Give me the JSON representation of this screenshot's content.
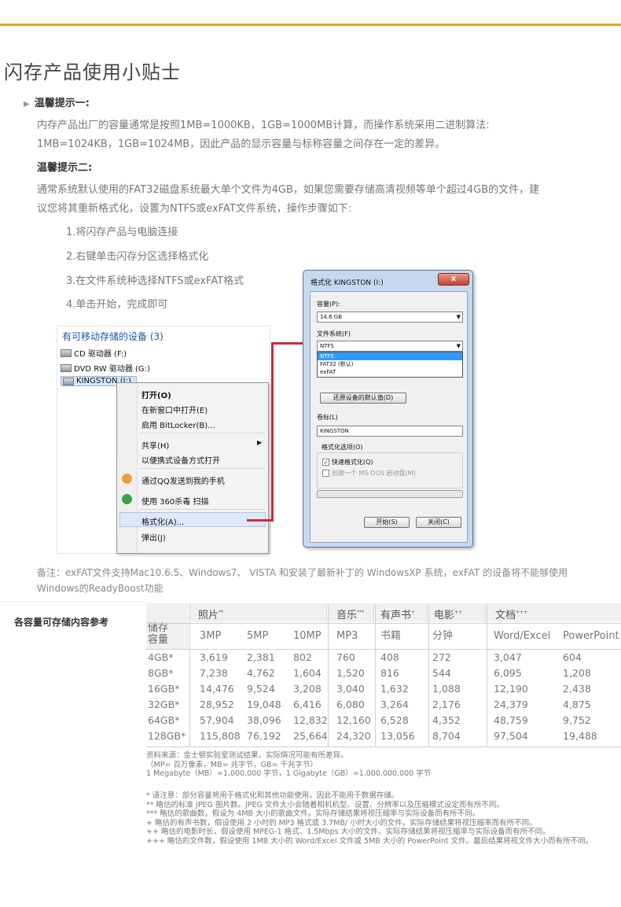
{
  "title": "闪存产品使用小贴士",
  "tip1": {
    "heading": "温馨提示一:",
    "line1": "内存产品出厂的容量通常是按照1MB=1000KB，1GB=1000MB计算，而操作系统采用二进制算法:",
    "line2": "1MB=1024KB，1GB=1024MB，因此产品的显示容量与标称容量之间存在一定的差异。"
  },
  "tip2": {
    "heading": "温馨提示二:",
    "line1": "通常系统默认使用的FAT32磁盘系统最大单个文件为4GB，如果您需要存储高清视频等单个超过4GB的文件，建",
    "line2": "议您将其重新格式化，设置为NTFS或exFAT文件系统，操作步骤如下:"
  },
  "steps": [
    "1.将闪存产品与电脑连接",
    "2.右键单击闪存分区选择格式化",
    "3.在文件系统种选择NTFS或exFAT格式",
    "4.单击开始，完成即可"
  ],
  "explorer": {
    "heading": "有可移动存储的设备 (3)",
    "drives": [
      "CD 驱动器 (F:)",
      "DVD RW 驱动器 (G:)",
      "KINGSTON (I:)"
    ]
  },
  "context_menu": {
    "items": [
      "打开(O)",
      "在新窗口中打开(E)",
      "启用 BitLocker(B)...",
      "共享(H)",
      "以便携式设备方式打开",
      "通过QQ发送到我的手机",
      "使用 360杀毒 扫描",
      "格式化(A)...",
      "弹出(J)"
    ]
  },
  "dialog": {
    "title": "格式化 KINGSTON (I:)",
    "close": "x",
    "capacity_label": "容量(P):",
    "capacity_value": "14.6 GB",
    "fs_label": "文件系统(F)",
    "fs_value": "NTFS",
    "fs_options": [
      "NTFS",
      "FAT32 (默认)",
      "exFAT"
    ],
    "restore_btn": "还原设备的默认值(D)",
    "volume_label": "卷标(L)",
    "volume_value": "KINGSTON",
    "options_label": "格式化选项(O)",
    "quick_format": "快速格式化(Q)",
    "msdos_disk": "创建一个 MS-DOS 启动盘(M)",
    "start_btn": "开始(S)",
    "close_btn": "关闭(C)"
  },
  "note": {
    "line1": "备注：exFAT文件支持Mac10.6.5、Windows7、  VISTA  和安装了最新补丁的 WindowsXP 系统，exFAT 的设备将不能够使用",
    "line2": "Windows的ReadyBoost功能"
  },
  "table": {
    "section_label": "各容量可存储内容参考",
    "corner_label_1": "储存",
    "corner_label_2": "容量",
    "groups": [
      {
        "name": "照片",
        "mark": "**"
      },
      {
        "name": "音乐",
        "mark": "***"
      },
      {
        "name": "有声书",
        "mark": "+"
      },
      {
        "name": "电影",
        "mark": "++"
      },
      {
        "name": "文档",
        "mark": "+++"
      }
    ],
    "subheaders": [
      "3MP",
      "5MP",
      "10MP",
      "MP3",
      "书籍",
      "分钟",
      "Word/Excel",
      "PowerPoint"
    ],
    "rows": [
      [
        "4GB*",
        "3,619",
        "2,381",
        "802",
        "760",
        "408",
        "272",
        "3,047",
        "604"
      ],
      [
        "8GB*",
        "7,238",
        "4,762",
        "1,604",
        "1,520",
        "816",
        "544",
        "6,095",
        "1,208"
      ],
      [
        "16GB*",
        "14,476",
        "9,524",
        "3,208",
        "3,040",
        "1,632",
        "1,088",
        "12,190",
        "2,438"
      ],
      [
        "32GB*",
        "28,952",
        "19,048",
        "6,416",
        "6,080",
        "3,264",
        "2,176",
        "24,379",
        "4,875"
      ],
      [
        "64GB*",
        "57,904",
        "38,096",
        "12,832",
        "12,160",
        "6,528",
        "4,352",
        "48,759",
        "9,752"
      ],
      [
        "128GB*",
        "115,808",
        "76,192",
        "25,664",
        "24,320",
        "13,056",
        "8,704",
        "97,504",
        "19,488"
      ]
    ]
  },
  "footnotes": {
    "source": [
      "资料来源：金士顿实验室测试结果，实际情况可能有所差异。",
      "（MP= 百万像素，MB= 兆字节，GB= 千兆字节）",
      "1 Megabyte（MB）=1,000,000 字节，1 Gigabyte（GB）=1,000,000,000 字节"
    ],
    "notes": [
      "* 请注意：部分容量将用于格式化和其他功能使用，因此不能用于数据存储。",
      "** 略估的标准 JPEG 图片数。JPEG 文件大小会随着相机机型、设置、分辨率以及压缩模式设定而有所不同。",
      "*** 略估的歌曲数，假设为 4MB 大小的歌曲文件。实际存储结果将视压缩率与实际设备而有所不同。",
      "+ 略估的有声书数，假设使用 2 小时的 MP3 格式或 3.7MB/ 小时大小的文件。实际存储结果将视压缩率而有所不同。",
      "++ 略估的电影时长，假设使用 MPEG-1 格式、1.5Mbps 大小的文件。实际存储结果将视压缩率与实际设备而有所不同。",
      "+++ 略估的文件数，假设使用 1MB 大小的 Word/Excel 文件或 5MB 大小的 PowerPoint 文件。最后结果将视文件大小而有所不同。"
    ]
  }
}
